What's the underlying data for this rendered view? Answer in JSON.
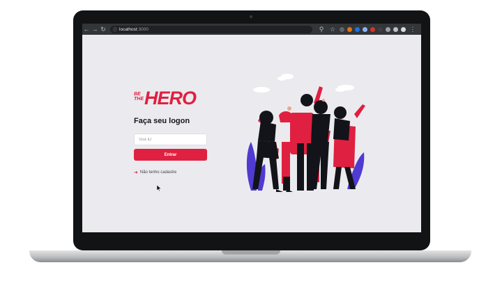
{
  "browser": {
    "url_host": "localhost",
    "url_port": ":3000"
  },
  "logo": {
    "small": "BE THE",
    "big": "HERO"
  },
  "logon": {
    "title": "Faça seu logon",
    "id_placeholder": "Sua ID",
    "submit_label": "Entrar",
    "register_link": "Não tenho cadastre"
  },
  "colors": {
    "accent": "#e02041",
    "background": "#ebebef",
    "text_dark": "#13131a"
  }
}
